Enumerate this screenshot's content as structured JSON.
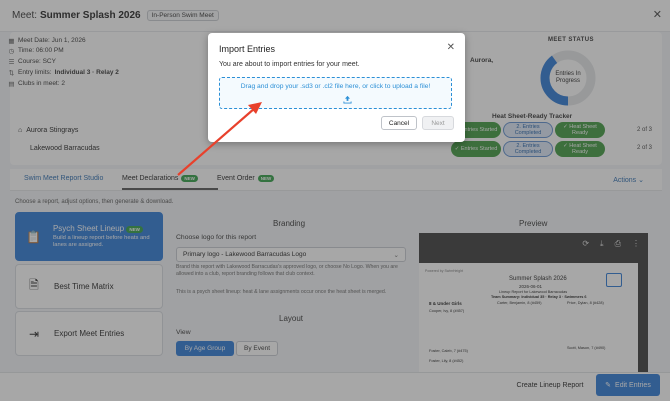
{
  "header": {
    "meet_label": "Meet:",
    "meet_name": "Summer Splash 2026",
    "meet_type": "In-Person Swim Meet"
  },
  "meet_info": {
    "date": "Meet Date: Jun 1, 2026",
    "time": "Time: 06:00 PM",
    "course": "Course: SCY",
    "entry_limits_label": "Entry limits:",
    "entry_limits_value": "Individual 3 · Relay 2",
    "clubs": "Clubs in meet: 2",
    "aurora_partial": "Aurora,"
  },
  "status": {
    "title": "MEET STATUS",
    "donut_label": "Entries In Progress",
    "progress_fraction": 0.4,
    "accent_color": "#2b78d6",
    "tracker_title": "Heat Sheet-Ready Tracker"
  },
  "teams": [
    {
      "name": "Aurora Stingrays",
      "count": "2 of 3",
      "badges": [
        "✓ Entries Started",
        "2. Entries Completed",
        "✓ Heat Sheet Ready"
      ]
    },
    {
      "name": "Lakewood Barracudas",
      "count": "2 of 3",
      "badges": [
        "✓ Entries Started",
        "2. Entries Completed",
        "✓ Heat Sheet Ready"
      ]
    }
  ],
  "tabs": {
    "studio": "Swim Meet Report Studio",
    "declarations": "Meet Declarations",
    "event_order": "Event Order",
    "new_tag": "NEW",
    "actions": "Actions"
  },
  "hint": "Choose a report, adjust options, then generate & download.",
  "reports": [
    {
      "title": "Psych Sheet Lineup",
      "tag": "NEW",
      "desc": "Build a lineup report before heats and lanes are assigned."
    },
    {
      "title": "Best Time Matrix",
      "desc": ""
    },
    {
      "title": "Export Meet Entries",
      "desc": ""
    }
  ],
  "branding": {
    "title": "Branding",
    "logo_label": "Choose logo for this report",
    "logo_value": "Primary logo - Lakewood Barracudas Logo",
    "logo_help": "Brand this report with Lakewood Barracudas's approved logo, or choose No Logo. When you are allowed into a club, report branding follows that club context.",
    "psych_note": "This is a psych sheet lineup: heat & lane assignments occur once the heat sheet is merged."
  },
  "layout": {
    "title": "Layout",
    "view_label": "View",
    "by_age_group": "By Age Group",
    "by_event": "By Event"
  },
  "preview": {
    "title": "Preview",
    "page_powered": "Powered by SwimHeight",
    "page_title": "Summer Splash 2026",
    "page_date": "2026-06-01",
    "page_sub": "Lineup Report for Lakewood Barracudas",
    "page_summary": "Team Summary: Individual 35 · Relay 3 · Swimmers 6",
    "section": "8 & Under Girls",
    "col1_a": "Cooper, Ivy, 8 (#457)",
    "col2_a": "Carter, Benjamin, 8 (#459)",
    "col3_a": "Price, Dylan, 8 (#428)",
    "col1_b": "Foster, Caleb, 7 (#475)",
    "col2_b": "Foster, Lily, 8 (#452)",
    "col3_b": "Scott, Mason, 7 (#490)"
  },
  "footer": {
    "create": "Create Lineup Report",
    "edit": "Edit Entries"
  },
  "modal": {
    "title": "Import Entries",
    "body": "You are about to import entries for your meet.",
    "dropzone_text": "Drag and drop your .sd3 or .cl2 file here, or click to upload a file!",
    "cancel": "Cancel",
    "next": "Next"
  },
  "colors": {
    "primary": "#2b78d6",
    "success": "#3f9a3f",
    "annotation_arrow": "#e8412c"
  }
}
